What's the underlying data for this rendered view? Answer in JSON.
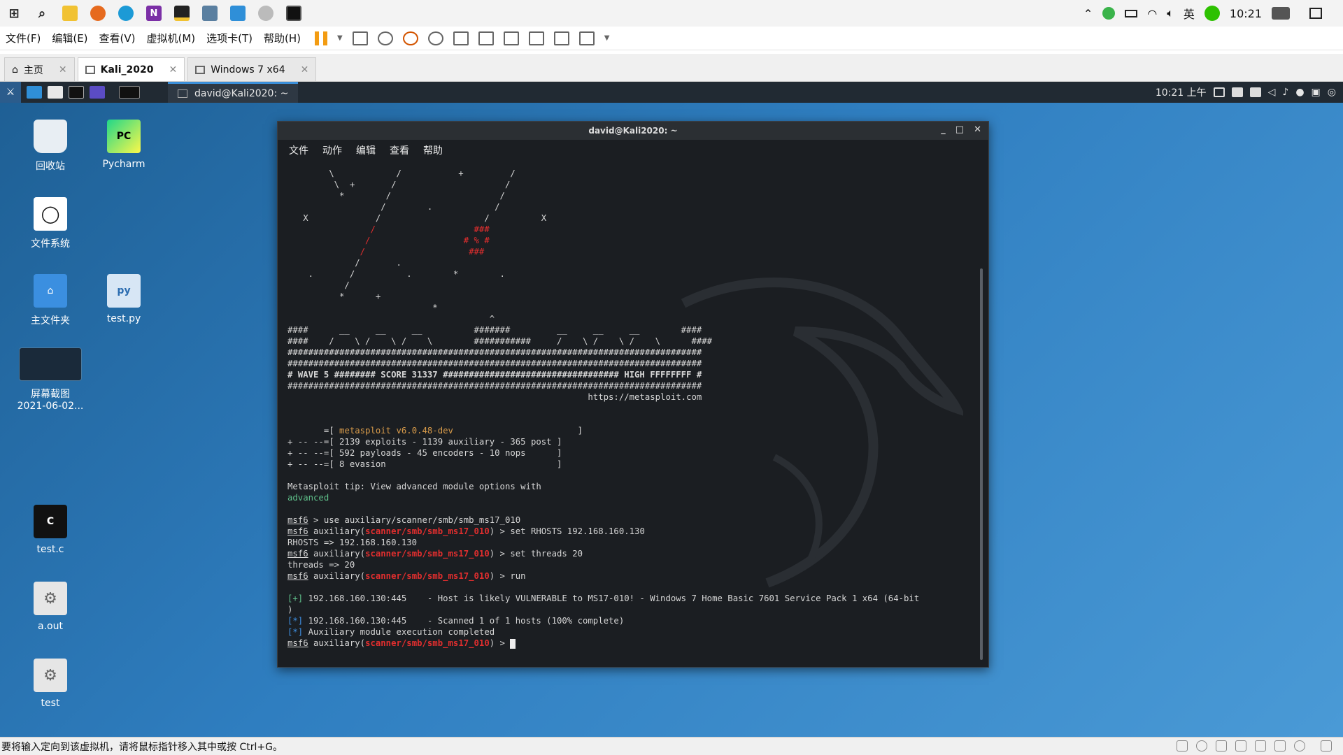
{
  "host": {
    "taskbar_icons": [
      "windows-start-icon",
      "search-icon",
      "file-explorer-icon",
      "firefox-icon",
      "edge-icon",
      "onenote-icon",
      "sticky-notes-icon",
      "vmware-icon",
      "screen-icon",
      "settings-icon",
      "terminal-icon"
    ],
    "tray": {
      "ime": "英",
      "time": "10:21"
    },
    "menu": [
      "文件(F)",
      "编辑(E)",
      "查看(V)",
      "虚拟机(M)",
      "选项卡(T)",
      "帮助(H)"
    ],
    "tabs": [
      {
        "label": "主页"
      },
      {
        "label": "Kali_2020"
      },
      {
        "label": "Windows 7 x64"
      }
    ],
    "status_text": "要将输入定向到该虚拟机，请将鼠标指针移入其中或按 Ctrl+G。"
  },
  "kali": {
    "task_label": "david@Kali2020: ~",
    "clock": "10:21 上午"
  },
  "desktop": {
    "icons": [
      {
        "label": "回收站"
      },
      {
        "label": "Pycharm"
      },
      {
        "label": "文件系统"
      },
      {
        "label": "主文件夹"
      },
      {
        "label": "test.py"
      },
      {
        "label": "屏幕截图\n2021-06-02..."
      },
      {
        "label": "test.c"
      },
      {
        "label": "a.out"
      },
      {
        "label": "test"
      }
    ]
  },
  "terminal": {
    "title": "david@Kali2020: ~",
    "menu": [
      "文件",
      "动作",
      "编辑",
      "查看",
      "帮助"
    ],
    "banner_ascii": [
      "        \\            /           +         /",
      "         \\  +       /                     /",
      "          *        /                     /",
      "                  /        .            /",
      "   X             /                    /          X",
      "                /                   ###",
      "               /                  # % #",
      "              /                    ###",
      "             /       .",
      "    .       /          .        *        .",
      "           /",
      "          *      +",
      "                            *",
      "",
      "                                       ^",
      "####      __     __     __          #######         __     __     __        ####",
      "####    /    \\ /    \\ /    \\        ###########     /    \\ /    \\ /    \\      ####",
      "################################################################################",
      "################################################################################",
      "# WAVE 5 ######## SCORE 31337 ################################## HIGH FFFFFFFF #",
      "################################################################################",
      "                                                          https://metasploit.com"
    ],
    "version": "metasploit v6.0.48-dev",
    "stats": [
      "2139 exploits - 1139 auxiliary - 365 post",
      "592 payloads - 45 encoders - 10 nops",
      "8 evasion"
    ],
    "tip_line": "Metasploit tip: View advanced module options with",
    "tip_word": "advanced",
    "prompt": "msf6",
    "module": "scanner/smb/smb_ms17_010",
    "commands": [
      "use auxiliary/scanner/smb/smb_ms17_010",
      "set RHOSTS 192.168.160.130",
      "set threads 20",
      "run"
    ],
    "responses": [
      "RHOSTS => 192.168.160.130",
      "threads => 20"
    ],
    "results": [
      "192.168.160.130:445    - Host is likely VULNERABLE to MS17-010! - Windows 7 Home Basic 7601 Service Pack 1 x64 (64-bit",
      ")",
      "192.168.160.130:445    - Scanned 1 of 1 hosts (100% complete)",
      "Auxiliary module execution completed"
    ]
  }
}
